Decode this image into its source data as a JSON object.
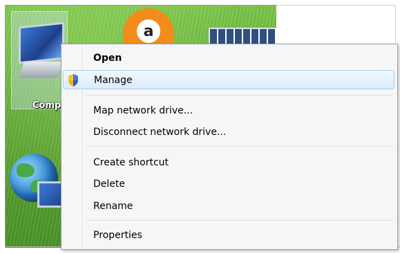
{
  "desktop": {
    "computer_icon_label": "Comp",
    "avast_glyph": "a"
  },
  "context_menu": {
    "items": [
      {
        "label": "Open",
        "bold": true
      },
      {
        "label": "Manage",
        "icon": "uac-shield-icon",
        "highlighted": true
      },
      {
        "label": "Map network drive..."
      },
      {
        "label": "Disconnect network drive..."
      },
      {
        "label": "Create shortcut"
      },
      {
        "label": "Delete"
      },
      {
        "label": "Rename"
      },
      {
        "label": "Properties"
      }
    ]
  },
  "colors": {
    "menu_background": "#f5f6f7",
    "highlight_border": "#a8cbf0",
    "desktop_green": "#5ea834"
  }
}
